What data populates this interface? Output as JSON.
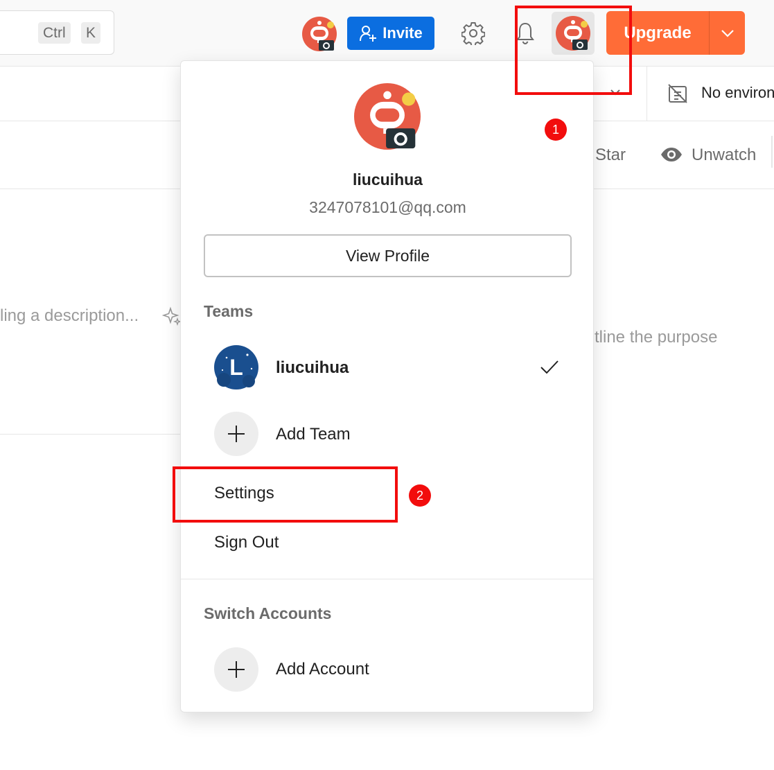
{
  "header": {
    "search_shortcut": [
      "Ctrl",
      "K"
    ],
    "invite_label": "Invite",
    "upgrade_label": "Upgrade"
  },
  "background": {
    "environment_label": "No environ",
    "star_label": "Star",
    "unwatch_label": "Unwatch",
    "description_placeholder": "ling a description...",
    "purpose_placeholder": "tline the purpose"
  },
  "menu": {
    "username": "liucuihua",
    "email": "3247078101@qq.com",
    "view_profile_label": "View Profile",
    "teams_heading": "Teams",
    "team": {
      "avatar_letter": "L",
      "name": "liucuihua"
    },
    "add_team_label": "Add Team",
    "settings_label": "Settings",
    "sign_out_label": "Sign Out",
    "switch_accounts_heading": "Switch Accounts",
    "add_account_label": "Add Account"
  },
  "annotations": {
    "badge_1": "1",
    "badge_2": "2"
  },
  "colors": {
    "brand_orange": "#ff6c37",
    "invite_blue": "#0b6ee0",
    "annotation_red": "#f20d0d",
    "avatar_coral": "#e75a45"
  }
}
